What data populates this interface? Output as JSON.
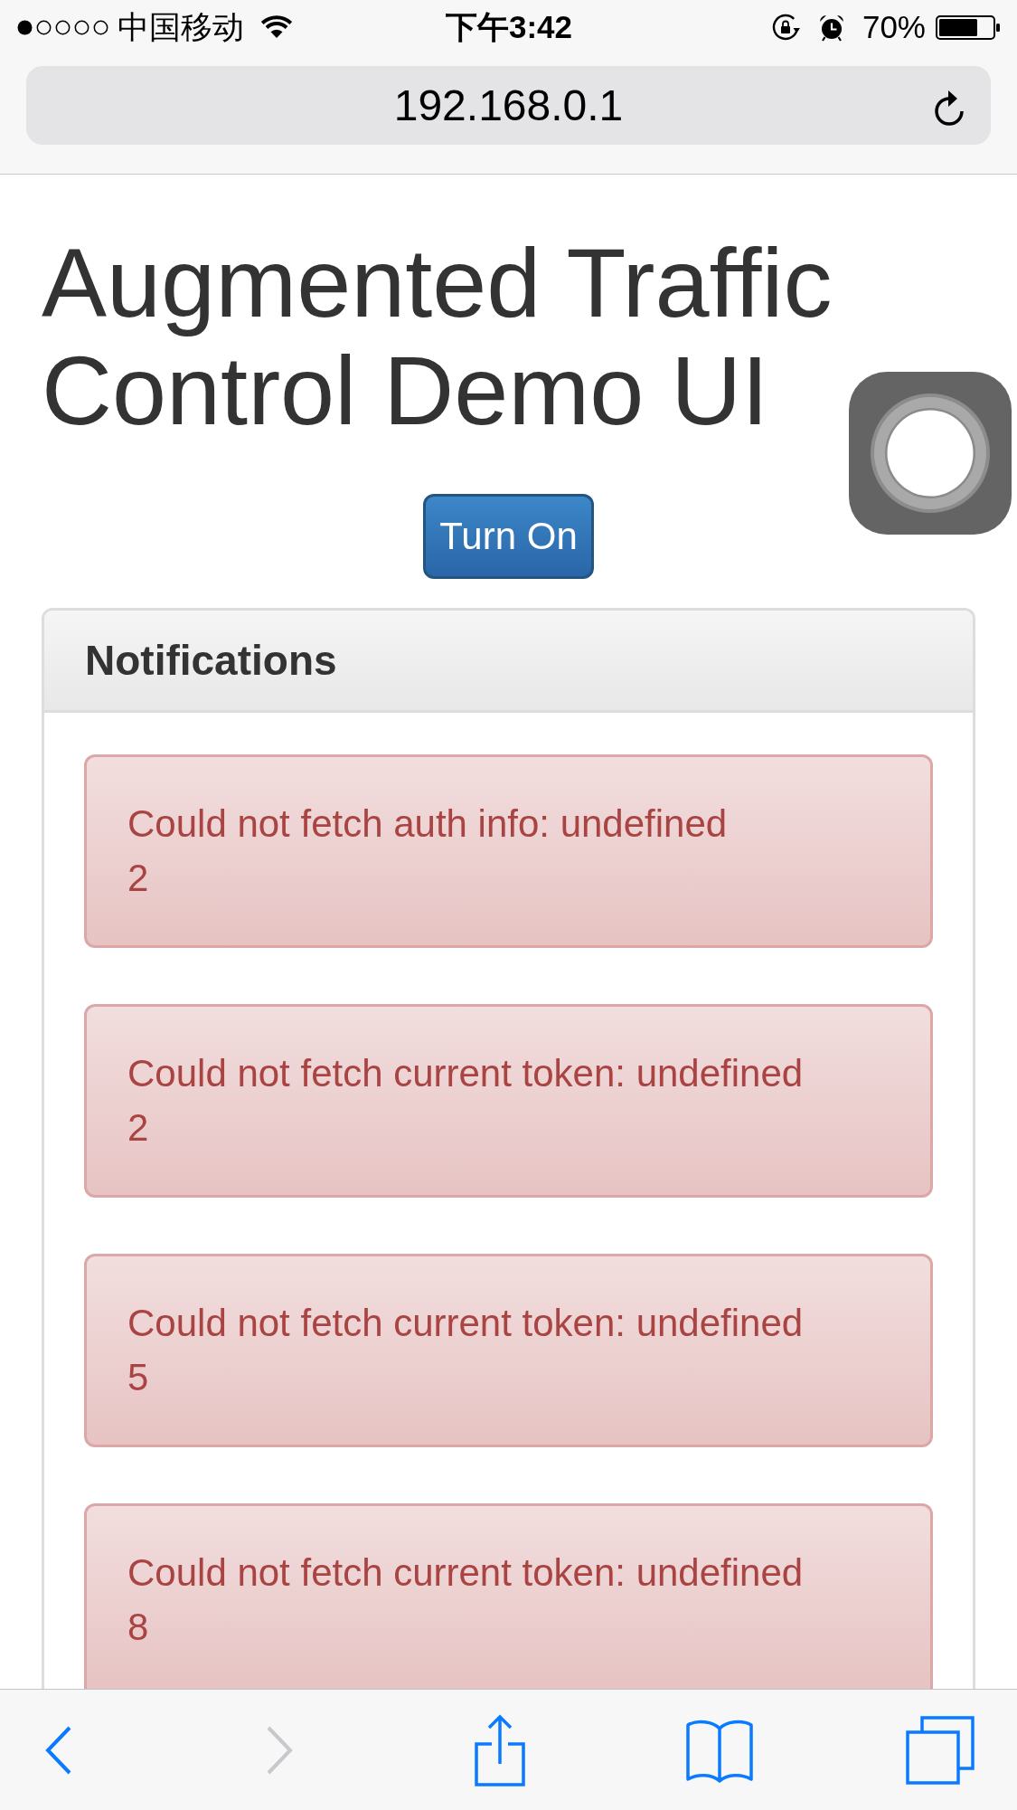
{
  "status_bar": {
    "carrier": "中国移动",
    "time": "下午3:42",
    "battery_percent": "70%"
  },
  "address_bar": {
    "value": "192.168.0.1"
  },
  "title": "Augmented Traffic Control Demo UI",
  "turn_on_button": {
    "label": "Turn On"
  },
  "notifications": {
    "title": "Notifications",
    "alerts": [
      {
        "message": "Could not fetch auth info: undefined",
        "count": "2"
      },
      {
        "message": "Could not fetch current token: undefined",
        "count": "2"
      },
      {
        "message": "Could not fetch current token: undefined",
        "count": "5"
      },
      {
        "message": "Could not fetch current token: undefined",
        "count": "8"
      }
    ]
  },
  "toolbar": [
    {
      "kind": "back",
      "disabled": false
    },
    {
      "kind": "forward",
      "disabled": true
    },
    {
      "kind": "share",
      "disabled": false
    },
    {
      "kind": "bookmarks",
      "disabled": false
    },
    {
      "kind": "tabs",
      "disabled": false
    }
  ]
}
